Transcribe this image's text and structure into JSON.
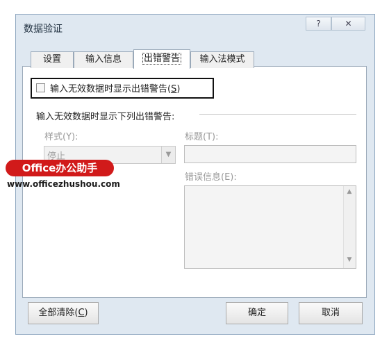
{
  "window": {
    "title": "数据验证",
    "help_glyph": "?",
    "close_glyph": "✕"
  },
  "tabs": [
    {
      "label": "设置",
      "active": false
    },
    {
      "label": "输入信息",
      "active": false
    },
    {
      "label": "出错警告",
      "active": true
    },
    {
      "label": "输入法模式",
      "active": false
    }
  ],
  "error_alert": {
    "show_checkbox_label": "输入无效数据时显示出错警告",
    "show_checkbox_key": "S",
    "show_checked": false,
    "section_label": "输入无效数据时显示下列出错警告:",
    "style_label": "样式(Y):",
    "style_value": "停止",
    "title_label": "标题(T):",
    "title_value": "",
    "message_label": "错误信息(E):",
    "message_value": ""
  },
  "buttons": {
    "clear_all_label": "全部清除",
    "clear_all_key": "C",
    "ok_label": "确定",
    "cancel_label": "取消"
  },
  "watermark": {
    "brand": "Office办公助手",
    "url": "www.officezhushou.com"
  },
  "icons": {
    "dropdown": "chevron-down-icon",
    "scroll_up": "scroll-up-icon",
    "scroll_down": "scroll-down-icon"
  },
  "colors": {
    "accent_red": "#d11a1a",
    "dialog_bg": "#dfe8f1"
  }
}
